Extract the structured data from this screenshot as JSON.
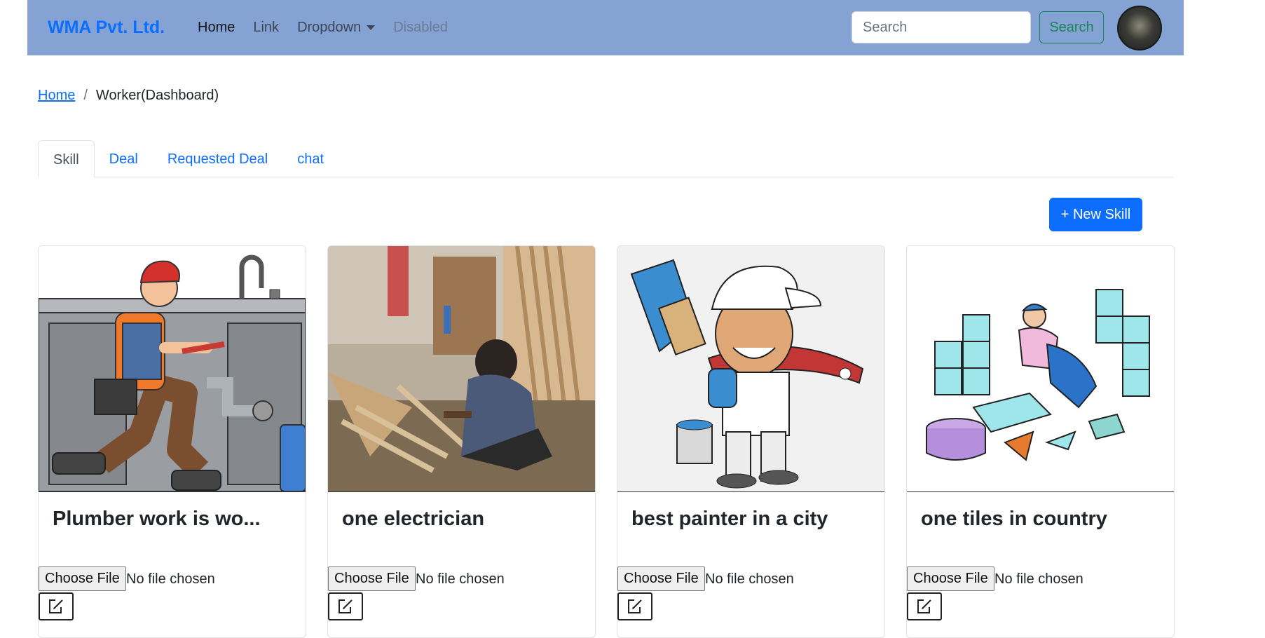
{
  "navbar": {
    "brand": "WMA Pvt. Ltd.",
    "links": [
      {
        "label": "Home"
      },
      {
        "label": "Link"
      },
      {
        "label": "Dropdown"
      },
      {
        "label": "Disabled"
      }
    ],
    "search_placeholder": "Search",
    "search_button": "Search",
    "colors": {
      "background": "#84a3d4",
      "brand": "#0d6efd",
      "search_button": "#198754"
    }
  },
  "breadcrumb": {
    "home": "Home",
    "separator": "/",
    "current": "Worker(Dashboard)"
  },
  "tabs": [
    {
      "label": "Skill",
      "active": true
    },
    {
      "label": "Deal"
    },
    {
      "label": "Requested Deal"
    },
    {
      "label": "chat"
    }
  ],
  "new_skill_button": "+ New Skill",
  "cards": [
    {
      "title": "Plumber work is wo...",
      "image": "plumber-illustration",
      "file_button": "Choose File",
      "file_status": "No file chosen",
      "edit_icon": "edit-icon"
    },
    {
      "title": "one electrician",
      "image": "carpenter-photo",
      "file_button": "Choose File",
      "file_status": "No file chosen",
      "edit_icon": "edit-icon"
    },
    {
      "title": "best painter in a city",
      "image": "painter-illustration",
      "file_button": "Choose File",
      "file_status": "No file chosen",
      "edit_icon": "edit-icon"
    },
    {
      "title": "one tiles in country",
      "image": "tiler-illustration",
      "file_button": "Choose File",
      "file_status": "No file chosen",
      "edit_icon": "edit-icon"
    }
  ]
}
